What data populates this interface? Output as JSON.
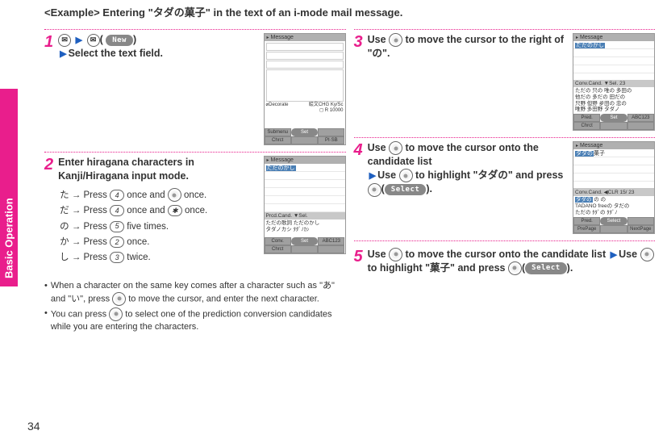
{
  "side_tab": {
    "label": "Basic Operation"
  },
  "example_header": "<Example> Entering \"タダの菓子\" in the text of an i-mode mail message.",
  "pill_new": "New",
  "pill_select": "Select",
  "phone_title_message": "Message",
  "step1": {
    "select_text": "Select the text field."
  },
  "step2": {
    "title": "Enter hiragana characters in Kanji/Hiragana input mode.",
    "rows": {
      "ta": {
        "ch": "た",
        "txt_a": " → Press ",
        "key1": "4",
        "txt_b": " once and ",
        "txt_c": " once."
      },
      "da": {
        "ch": "だ",
        "txt_a": " → Press ",
        "key1": "4",
        "txt_b": " once and ",
        "key2": "✱",
        "txt_c": " once."
      },
      "no": {
        "ch": "の",
        "txt_a": " → Press ",
        "key1": "5",
        "txt_b": " five times."
      },
      "ka": {
        "ch": "か",
        "txt_a": " → Press ",
        "key1": "2",
        "txt_b": " once."
      },
      "shi": {
        "ch": "し",
        "txt_a": " → Press ",
        "key1": "3",
        "txt_b": " twice."
      }
    },
    "bullets": {
      "b1a": "When a character on the same key comes after a character such as \"あ\" and \"い\", press ",
      "b1b": " to move the cursor, and enter the next character.",
      "b2a": "You can press ",
      "b2b": " to select one of the prediction conversion candidates while you are entering the characters."
    }
  },
  "step3": {
    "text_a": "Use ",
    "text_b": " to move the cursor to the right of \"の\"."
  },
  "step4": {
    "text_a": "Use ",
    "text_b": " to move the cursor onto the candidate list",
    "text_c": "Use ",
    "text_d": " to highlight \"タダの\" and press ",
    "text_e": "(",
    "text_f": ")."
  },
  "step5": {
    "text_a": "Use ",
    "text_b": " to move the cursor onto the candidate list",
    "text_c": "Use ",
    "text_d": " to highlight \"菓子\" and press ",
    "text_e": "(",
    "text_f": ")."
  },
  "shots": {
    "s1": {
      "foot1": "Submenu",
      "foot2": "Set",
      "foot3": "",
      "foot4": "Chrct",
      "foot5": "",
      "foot6": "PI·SB",
      "bottom_left": "⌀Decorate",
      "bottom_right": "絵文CHG Ky/Sc",
      "status": "◻  R  10000"
    },
    "s2": {
      "line": "ただのかし",
      "pred_row": "Prcd.Cand. ▼Sel.",
      "pred1": "ただの歌詞 ただのかし",
      "pred2": "タダノカシ ﾀﾀﾞﾉｶｼ",
      "foot1": "Conv.",
      "foot2": "Set",
      "foot3": "ABC123",
      "foot4": "Chrct",
      "foot5": "",
      "foot6": ""
    },
    "s3": {
      "line": "ただのかし",
      "conv_row": "Conv.Cand. ▼Sel.        23",
      "l1": "ただの 只の 唯の 多田の",
      "l2": "他だの 多だの 田だの",
      "l3": "只野 但野 夛田の 忠の",
      "l4": "唯野 多田野 タダノ",
      "foot1": "Pred.",
      "foot2": "",
      "foot3": "ABC123",
      "foot4": "Chrct",
      "foot5": "Set",
      "foot6": ""
    },
    "s4": {
      "line_hl": "タダの",
      "line_rest": "菓子",
      "conv_row": "Conv.Cand. ◀CLR      15/ 23",
      "l1_pre": "タダの",
      "l1_mid": " の ",
      "l1_post": "の",
      "l2": "TADANO freeの タだの",
      "l3": "ただの ﾀﾀﾞの ﾀﾀﾞﾉ",
      "foot1": "Pred.",
      "foot2": "Select",
      "foot3": "",
      "foot4": "PrePage",
      "foot5": "",
      "foot6": "NextPage"
    }
  },
  "page_number": "34"
}
